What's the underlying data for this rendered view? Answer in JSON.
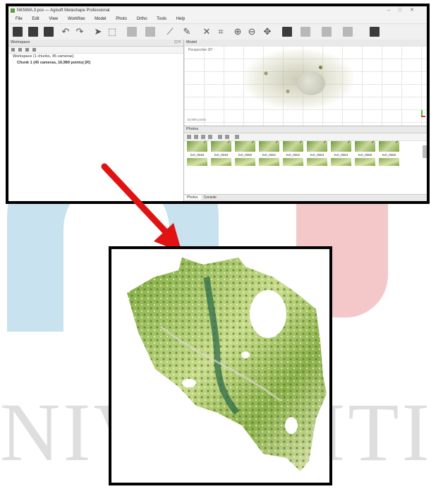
{
  "window": {
    "title": "NKNWA.3.psx — Agisoft Metashape Professional",
    "controls": [
      "–",
      "□",
      "✕"
    ]
  },
  "menu": [
    "File",
    "Edit",
    "View",
    "Workflow",
    "Model",
    "Photo",
    "Ortho",
    "Tools",
    "Help"
  ],
  "workspace": {
    "header": "Workspace",
    "root": "Workspace (1 chunks, 45 cameras)",
    "chunk": "Chunk 1 (45 cameras, 16,989 points) [R]"
  },
  "model_view": {
    "header": "Model",
    "projection": "Perspective 30°",
    "points_label": "16,989 points"
  },
  "photos": {
    "header": "Photos",
    "labels": [
      "DJI_0048",
      "DJI_0049",
      "DJI_0050",
      "DJI_0051",
      "DJI_0052",
      "DJI_0053",
      "DJI_0054",
      "DJI_0055",
      "DJI_0056"
    ],
    "bottom_tabs": [
      "Photos",
      "Console"
    ]
  },
  "watermark_text": "NIVERSITI",
  "colors": {
    "arrow": "#e01212",
    "vegetation": "#6e9a3e"
  }
}
